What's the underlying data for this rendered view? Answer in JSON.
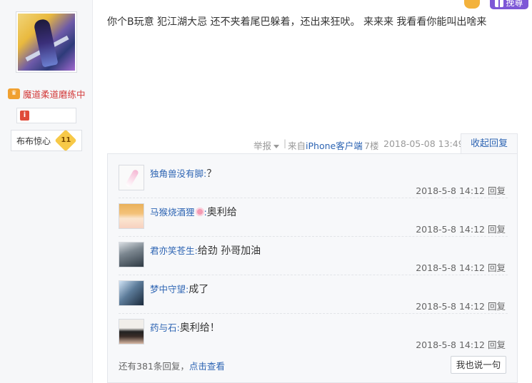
{
  "author": {
    "avatar_icon": "warrior-avatar",
    "rank_text": "魔道柔道磨练中",
    "level_name": "布布惊心",
    "level_number": "11"
  },
  "top_actions": {
    "gift_label": "挽尊"
  },
  "post": {
    "text": "你个B玩意 犯江湖大忌 还不夹着尾巴躲着，还出来狂吠。 来来来 我看看你能叫出啥来"
  },
  "tail": {
    "report_label": "举报",
    "separator": "|",
    "from_prefix": "来自",
    "client_link": "iPhone客户端",
    "floor": "7楼",
    "date": "2018-05-08 13:49",
    "collapse_label": "收起回复"
  },
  "replies": [
    {
      "user": "独角兽没有脚",
      "colon": ":",
      "text": "？",
      "time": "2018-5-8 14:12",
      "reply_label": "回复",
      "avatar_icon": "unicorn-avatar"
    },
    {
      "user": "马猴烧酒狸",
      "colon": ":",
      "text": "奥利给",
      "time": "2018-5-8 14:12",
      "reply_label": "回复",
      "avatar_icon": "anime-girl-avatar"
    },
    {
      "user": "君亦笑苍生",
      "colon": ":",
      "text": "给劲 孙哥加油",
      "time": "2018-5-8 14:12",
      "reply_label": "回复",
      "avatar_icon": "figure-avatar"
    },
    {
      "user": "梦中守望",
      "colon": ":",
      "text": "成了",
      "time": "2018-5-8 14:12",
      "reply_label": "回复",
      "avatar_icon": "sky-avatar"
    },
    {
      "user": "药与石",
      "colon": ":",
      "text": "奥利给！",
      "time": "2018-5-8 14:12",
      "reply_label": "回复",
      "avatar_icon": "boy-avatar"
    }
  ],
  "footer": {
    "more_prefix": "还有381条回复，",
    "more_link": "点击查看",
    "say_button": "我也说一句"
  },
  "colors": {
    "link_blue": "#2d64b3",
    "rank_red": "#d33b3b",
    "gift_purple": "#7d57d6"
  }
}
